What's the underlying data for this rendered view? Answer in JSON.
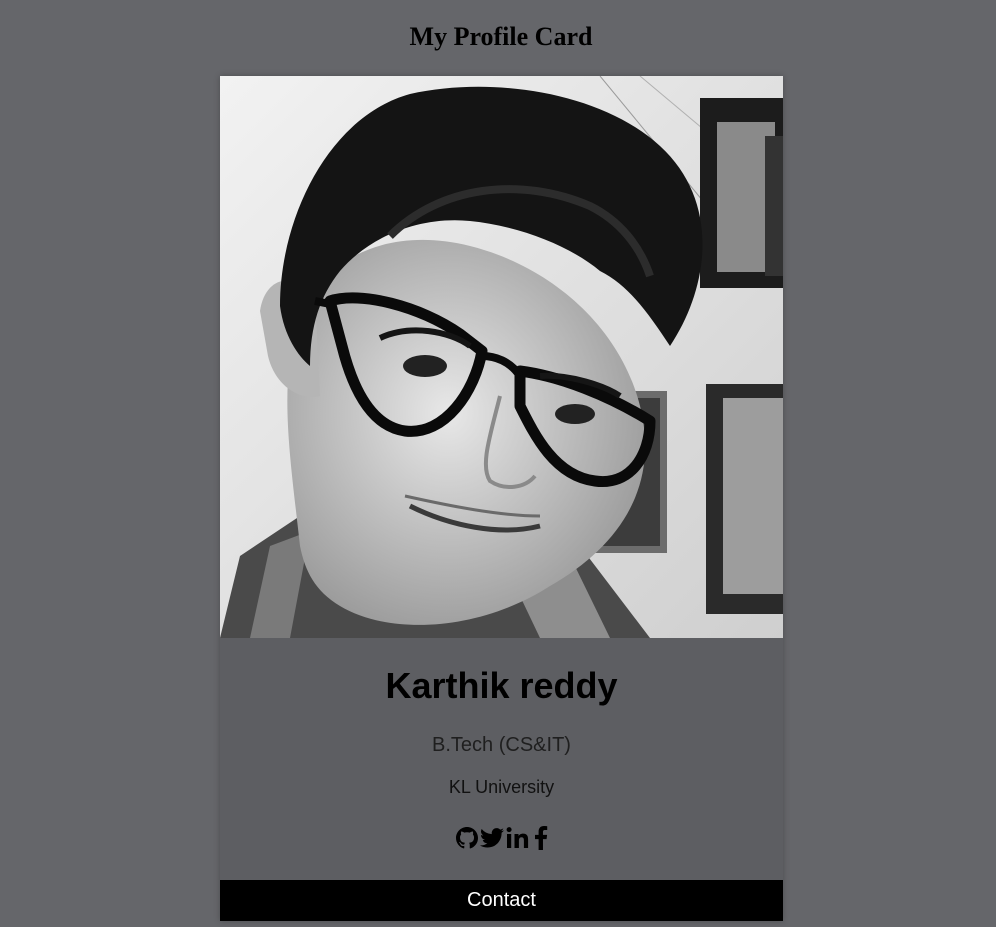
{
  "page": {
    "heading": "My Profile Card"
  },
  "profile": {
    "photo_description": "Black and white portrait photo",
    "name": "Karthik reddy",
    "title": "B.Tech (CS&IT)",
    "school": "KL University"
  },
  "socials": [
    {
      "icon": "github-icon"
    },
    {
      "icon": "twitter-icon"
    },
    {
      "icon": "linkedin-icon"
    },
    {
      "icon": "facebook-icon"
    }
  ],
  "actions": {
    "contact_label": "Contact"
  },
  "colors": {
    "background": "#65666a",
    "card": "#5d5e62",
    "button": "#000000",
    "button_text": "#ffffff"
  }
}
